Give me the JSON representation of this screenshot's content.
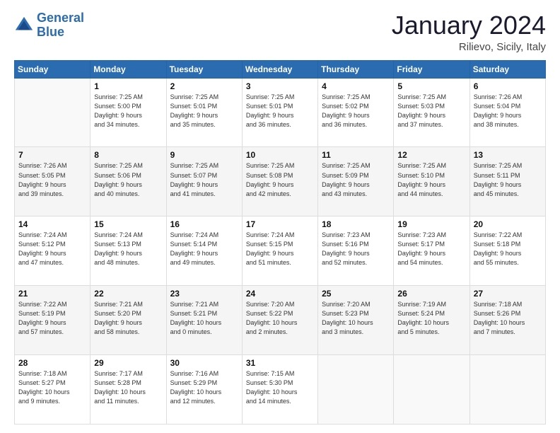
{
  "header": {
    "logo_line1": "General",
    "logo_line2": "Blue",
    "month_title": "January 2024",
    "location": "Rilievo, Sicily, Italy"
  },
  "weekdays": [
    "Sunday",
    "Monday",
    "Tuesday",
    "Wednesday",
    "Thursday",
    "Friday",
    "Saturday"
  ],
  "weeks": [
    [
      {
        "day": "",
        "sunrise": "",
        "sunset": "",
        "daylight": "",
        "empty": true
      },
      {
        "day": "1",
        "sunrise": "Sunrise: 7:25 AM",
        "sunset": "Sunset: 5:00 PM",
        "daylight": "Daylight: 9 hours and 34 minutes."
      },
      {
        "day": "2",
        "sunrise": "Sunrise: 7:25 AM",
        "sunset": "Sunset: 5:01 PM",
        "daylight": "Daylight: 9 hours and 35 minutes."
      },
      {
        "day": "3",
        "sunrise": "Sunrise: 7:25 AM",
        "sunset": "Sunset: 5:01 PM",
        "daylight": "Daylight: 9 hours and 36 minutes."
      },
      {
        "day": "4",
        "sunrise": "Sunrise: 7:25 AM",
        "sunset": "Sunset: 5:02 PM",
        "daylight": "Daylight: 9 hours and 36 minutes."
      },
      {
        "day": "5",
        "sunrise": "Sunrise: 7:25 AM",
        "sunset": "Sunset: 5:03 PM",
        "daylight": "Daylight: 9 hours and 37 minutes."
      },
      {
        "day": "6",
        "sunrise": "Sunrise: 7:26 AM",
        "sunset": "Sunset: 5:04 PM",
        "daylight": "Daylight: 9 hours and 38 minutes."
      }
    ],
    [
      {
        "day": "7",
        "sunrise": "Sunrise: 7:26 AM",
        "sunset": "Sunset: 5:05 PM",
        "daylight": "Daylight: 9 hours and 39 minutes."
      },
      {
        "day": "8",
        "sunrise": "Sunrise: 7:25 AM",
        "sunset": "Sunset: 5:06 PM",
        "daylight": "Daylight: 9 hours and 40 minutes."
      },
      {
        "day": "9",
        "sunrise": "Sunrise: 7:25 AM",
        "sunset": "Sunset: 5:07 PM",
        "daylight": "Daylight: 9 hours and 41 minutes."
      },
      {
        "day": "10",
        "sunrise": "Sunrise: 7:25 AM",
        "sunset": "Sunset: 5:08 PM",
        "daylight": "Daylight: 9 hours and 42 minutes."
      },
      {
        "day": "11",
        "sunrise": "Sunrise: 7:25 AM",
        "sunset": "Sunset: 5:09 PM",
        "daylight": "Daylight: 9 hours and 43 minutes."
      },
      {
        "day": "12",
        "sunrise": "Sunrise: 7:25 AM",
        "sunset": "Sunset: 5:10 PM",
        "daylight": "Daylight: 9 hours and 44 minutes."
      },
      {
        "day": "13",
        "sunrise": "Sunrise: 7:25 AM",
        "sunset": "Sunset: 5:11 PM",
        "daylight": "Daylight: 9 hours and 45 minutes."
      }
    ],
    [
      {
        "day": "14",
        "sunrise": "Sunrise: 7:24 AM",
        "sunset": "Sunset: 5:12 PM",
        "daylight": "Daylight: 9 hours and 47 minutes."
      },
      {
        "day": "15",
        "sunrise": "Sunrise: 7:24 AM",
        "sunset": "Sunset: 5:13 PM",
        "daylight": "Daylight: 9 hours and 48 minutes."
      },
      {
        "day": "16",
        "sunrise": "Sunrise: 7:24 AM",
        "sunset": "Sunset: 5:14 PM",
        "daylight": "Daylight: 9 hours and 49 minutes."
      },
      {
        "day": "17",
        "sunrise": "Sunrise: 7:24 AM",
        "sunset": "Sunset: 5:15 PM",
        "daylight": "Daylight: 9 hours and 51 minutes."
      },
      {
        "day": "18",
        "sunrise": "Sunrise: 7:23 AM",
        "sunset": "Sunset: 5:16 PM",
        "daylight": "Daylight: 9 hours and 52 minutes."
      },
      {
        "day": "19",
        "sunrise": "Sunrise: 7:23 AM",
        "sunset": "Sunset: 5:17 PM",
        "daylight": "Daylight: 9 hours and 54 minutes."
      },
      {
        "day": "20",
        "sunrise": "Sunrise: 7:22 AM",
        "sunset": "Sunset: 5:18 PM",
        "daylight": "Daylight: 9 hours and 55 minutes."
      }
    ],
    [
      {
        "day": "21",
        "sunrise": "Sunrise: 7:22 AM",
        "sunset": "Sunset: 5:19 PM",
        "daylight": "Daylight: 9 hours and 57 minutes."
      },
      {
        "day": "22",
        "sunrise": "Sunrise: 7:21 AM",
        "sunset": "Sunset: 5:20 PM",
        "daylight": "Daylight: 9 hours and 58 minutes."
      },
      {
        "day": "23",
        "sunrise": "Sunrise: 7:21 AM",
        "sunset": "Sunset: 5:21 PM",
        "daylight": "Daylight: 10 hours and 0 minutes."
      },
      {
        "day": "24",
        "sunrise": "Sunrise: 7:20 AM",
        "sunset": "Sunset: 5:22 PM",
        "daylight": "Daylight: 10 hours and 2 minutes."
      },
      {
        "day": "25",
        "sunrise": "Sunrise: 7:20 AM",
        "sunset": "Sunset: 5:23 PM",
        "daylight": "Daylight: 10 hours and 3 minutes."
      },
      {
        "day": "26",
        "sunrise": "Sunrise: 7:19 AM",
        "sunset": "Sunset: 5:24 PM",
        "daylight": "Daylight: 10 hours and 5 minutes."
      },
      {
        "day": "27",
        "sunrise": "Sunrise: 7:18 AM",
        "sunset": "Sunset: 5:26 PM",
        "daylight": "Daylight: 10 hours and 7 minutes."
      }
    ],
    [
      {
        "day": "28",
        "sunrise": "Sunrise: 7:18 AM",
        "sunset": "Sunset: 5:27 PM",
        "daylight": "Daylight: 10 hours and 9 minutes."
      },
      {
        "day": "29",
        "sunrise": "Sunrise: 7:17 AM",
        "sunset": "Sunset: 5:28 PM",
        "daylight": "Daylight: 10 hours and 11 minutes."
      },
      {
        "day": "30",
        "sunrise": "Sunrise: 7:16 AM",
        "sunset": "Sunset: 5:29 PM",
        "daylight": "Daylight: 10 hours and 12 minutes."
      },
      {
        "day": "31",
        "sunrise": "Sunrise: 7:15 AM",
        "sunset": "Sunset: 5:30 PM",
        "daylight": "Daylight: 10 hours and 14 minutes."
      },
      {
        "day": "",
        "sunrise": "",
        "sunset": "",
        "daylight": "",
        "empty": true
      },
      {
        "day": "",
        "sunrise": "",
        "sunset": "",
        "daylight": "",
        "empty": true
      },
      {
        "day": "",
        "sunrise": "",
        "sunset": "",
        "daylight": "",
        "empty": true
      }
    ]
  ]
}
